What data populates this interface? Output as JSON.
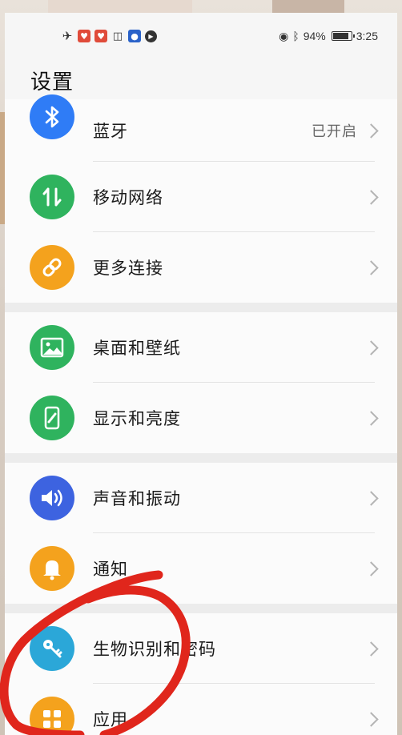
{
  "status_bar": {
    "battery": "94%",
    "battery_level": 0.94,
    "time": "3:25",
    "left_icons": [
      "airplane-icon",
      "app-icon-red",
      "app-icon-red-2",
      "shield-icon",
      "app-icon-blue",
      "play-icon"
    ],
    "right_icons": [
      "eye-icon",
      "bluetooth-icon",
      "battery-icon"
    ]
  },
  "page": {
    "title": "设置"
  },
  "groups": [
    {
      "items": [
        {
          "label": "蓝牙",
          "value": "已开启",
          "icon": "bluetooth-icon",
          "color": "#2f7cf6"
        },
        {
          "label": "移动网络",
          "value": "",
          "icon": "mobile-data-icon",
          "color": "#2fb35e"
        },
        {
          "label": "更多连接",
          "value": "",
          "icon": "link-icon",
          "color": "#f4a21d"
        }
      ]
    },
    {
      "items": [
        {
          "label": "桌面和壁纸",
          "value": "",
          "icon": "image-icon",
          "color": "#2fb35e"
        },
        {
          "label": "显示和亮度",
          "value": "",
          "icon": "phone-brightness-icon",
          "color": "#2fb35e"
        }
      ]
    },
    {
      "items": [
        {
          "label": "声音和振动",
          "value": "",
          "icon": "speaker-icon",
          "color": "#3d63e0"
        },
        {
          "label": "通知",
          "value": "",
          "icon": "bell-icon",
          "color": "#f4a21d"
        }
      ]
    },
    {
      "items": [
        {
          "label": "生物识别和密码",
          "value": "",
          "icon": "key-icon",
          "color": "#2ba7d8"
        },
        {
          "label": "应用",
          "value": "",
          "icon": "apps-grid-icon",
          "color": "#f4a21d"
        }
      ]
    }
  ],
  "annotation": {
    "color": "#e0261c",
    "icon": "red-circle-annotation"
  }
}
